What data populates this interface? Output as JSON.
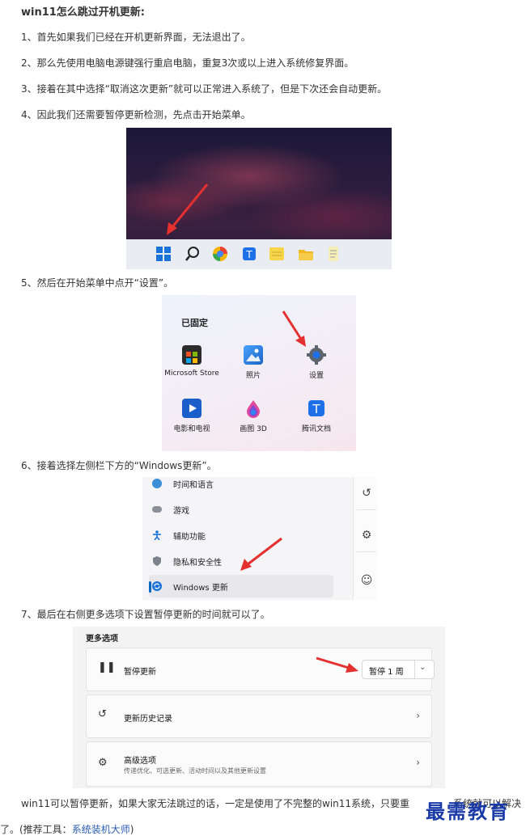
{
  "article": {
    "title": "win11怎么跳过开机更新:",
    "steps": [
      "1、首先如果我们已经在开机更新界面，无法退出了。",
      "2、那么先使用电脑电源键强行重启电脑，重复3次或以上进入系统修复界面。",
      "3、接着在其中选择“取消这次更新”就可以正常进入系统了，但是下次还会自动更新。",
      "4、因此我们还需要暂停更新检测，先点击开始菜单。",
      "5、然后在开始菜单中点开“设置”。",
      "6、接着选择左侧栏下方的“Windows更新”。",
      "7、最后在右侧更多选项下设置暂停更新的时间就可以了。"
    ],
    "conclusion_line1": "win11可以暂停更新，如果大家无法跳过的话，一定是使用了不完整的win11系统，只要重",
    "conclusion_line1_tail": "系统就可以解决",
    "conclusion_line2_prefix": "了。(推荐工具：",
    "conclusion_link": "系统装机大师",
    "conclusion_line2_suffix": ")"
  },
  "start_menu": {
    "heading": "已固定",
    "apps": [
      {
        "label": "Microsoft Store",
        "icon": "store-icon"
      },
      {
        "label": "照片",
        "icon": "photos-icon"
      },
      {
        "label": "设置",
        "icon": "settings-gear-icon"
      },
      {
        "label": "电影和电视",
        "icon": "movies-icon"
      },
      {
        "label": "画图 3D",
        "icon": "paint3d-icon"
      },
      {
        "label": "腾讯文档",
        "icon": "tencent-docs-icon"
      }
    ]
  },
  "settings_nav": {
    "items": [
      {
        "label": "时间和语言",
        "icon": "clock-globe-icon"
      },
      {
        "label": "游戏",
        "icon": "gamepad-icon"
      },
      {
        "label": "辅助功能",
        "icon": "accessibility-icon"
      },
      {
        "label": "隐私和安全性",
        "icon": "shield-icon"
      },
      {
        "label": "Windows 更新",
        "icon": "update-icon",
        "selected": true
      }
    ]
  },
  "more_options": {
    "heading": "更多选项",
    "pause": {
      "label": "暂停更新",
      "button": "暂停 1 周"
    },
    "history": {
      "label": "更新历史记录"
    },
    "advanced": {
      "label": "高级选项",
      "sub": "传递优化、可选更新、活动时间以及其他更新设置"
    }
  },
  "watermark": "最需教育",
  "colors": {
    "accent": "#0067c0",
    "arrow": "#e53030",
    "link": "#2a5db0"
  }
}
